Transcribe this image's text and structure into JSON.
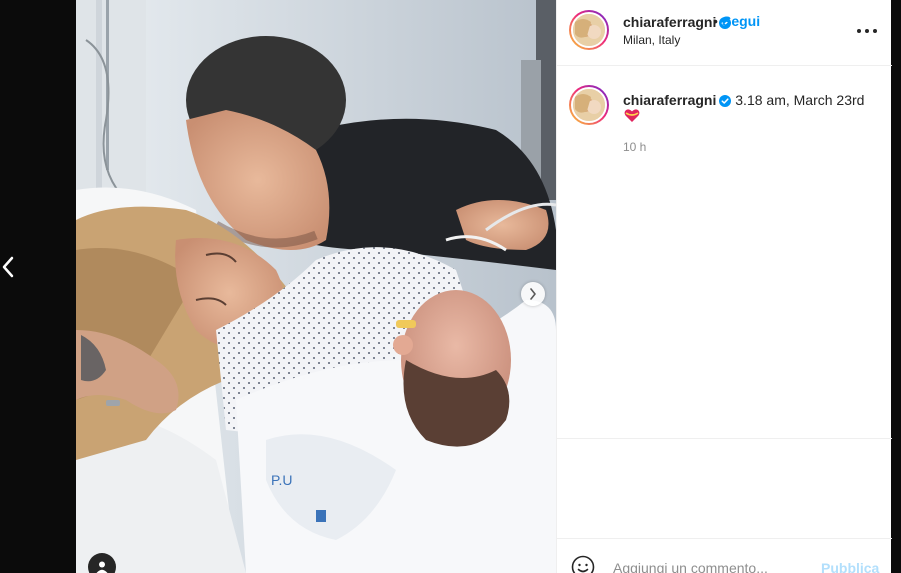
{
  "post": {
    "username": "chiaraferragni",
    "verified": true,
    "follow_separator": "•",
    "follow_label": "Segui",
    "location": "Milan, Italy",
    "more_icon": "more-horizontal-icon"
  },
  "caption": {
    "username": "chiaraferragni",
    "text": "3.18 am, March 23rd",
    "emoji": "heart-ribbon-emoji",
    "time_ago": "10 h"
  },
  "comment_box": {
    "placeholder": "Aggiungi un commento...",
    "publish_label": "Pubblica"
  },
  "media": {
    "carousel_next": "chevron-right-icon",
    "tagged_users": "user-tag-icon"
  },
  "navigation": {
    "previous": "chevron-left-icon"
  },
  "colors": {
    "link_blue": "#0095f6",
    "publish_disabled": "#b2dffc",
    "verified_badge": "#0095f6",
    "secondary_text": "#8e8e8e"
  }
}
